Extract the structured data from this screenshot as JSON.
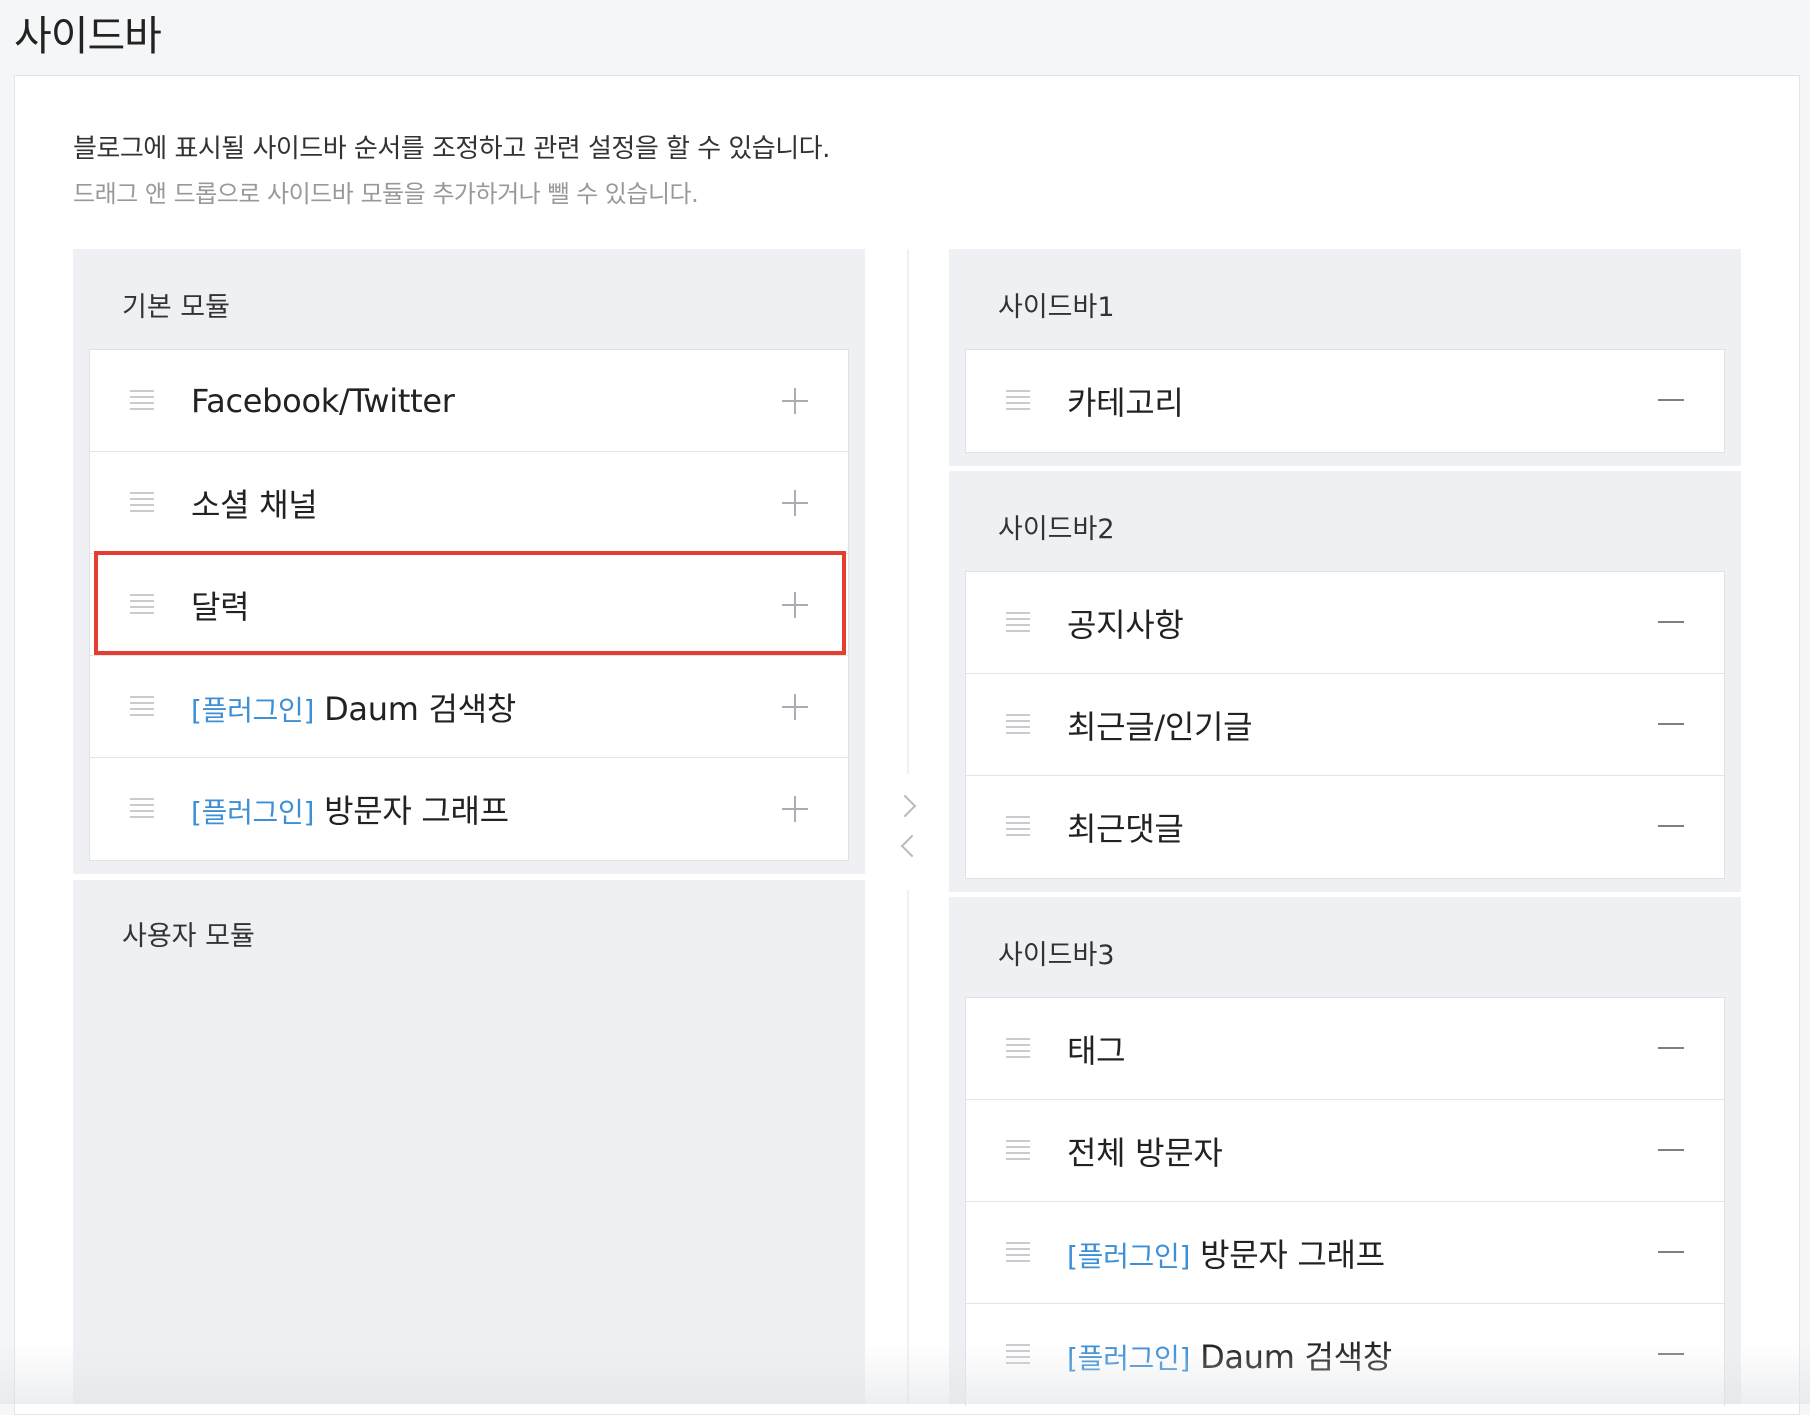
{
  "page": {
    "title": "사이드바",
    "description": "블로그에 표시될 사이드바 순서를 조정하고 관련 설정을 할 수 있습니다.",
    "subdescription": "드래그 앤 드롭으로 사이드바 모듈을 추가하거나 뺄 수 있습니다."
  },
  "left": {
    "basic": {
      "title": "기본 모듈",
      "items": [
        {
          "tag": "",
          "label": "Facebook/Twitter"
        },
        {
          "tag": "",
          "label": "소셜 채널"
        },
        {
          "tag": "",
          "label": "달력"
        },
        {
          "tag": "[플러그인]",
          "label": "Daum 검색창"
        },
        {
          "tag": "[플러그인]",
          "label": "방문자 그래프"
        }
      ]
    },
    "user": {
      "title": "사용자 모듈"
    }
  },
  "right": {
    "sidebar1": {
      "title": "사이드바1",
      "items": [
        {
          "tag": "",
          "label": "카테고리"
        }
      ]
    },
    "sidebar2": {
      "title": "사이드바2",
      "items": [
        {
          "tag": "",
          "label": "공지사항"
        },
        {
          "tag": "",
          "label": "최근글/인기글"
        },
        {
          "tag": "",
          "label": "최근댓글"
        }
      ]
    },
    "sidebar3": {
      "title": "사이드바3",
      "items": [
        {
          "tag": "",
          "label": "태그"
        },
        {
          "tag": "",
          "label": "전체 방문자"
        },
        {
          "tag": "[플러그인]",
          "label": "방문자 그래프"
        },
        {
          "tag": "[플러그인]",
          "label": "Daum 검색창"
        }
      ]
    }
  },
  "colors": {
    "accent_tag": "#3d8fd6",
    "highlight": "#e53d2f",
    "panel_bg": "#eef0f3"
  }
}
